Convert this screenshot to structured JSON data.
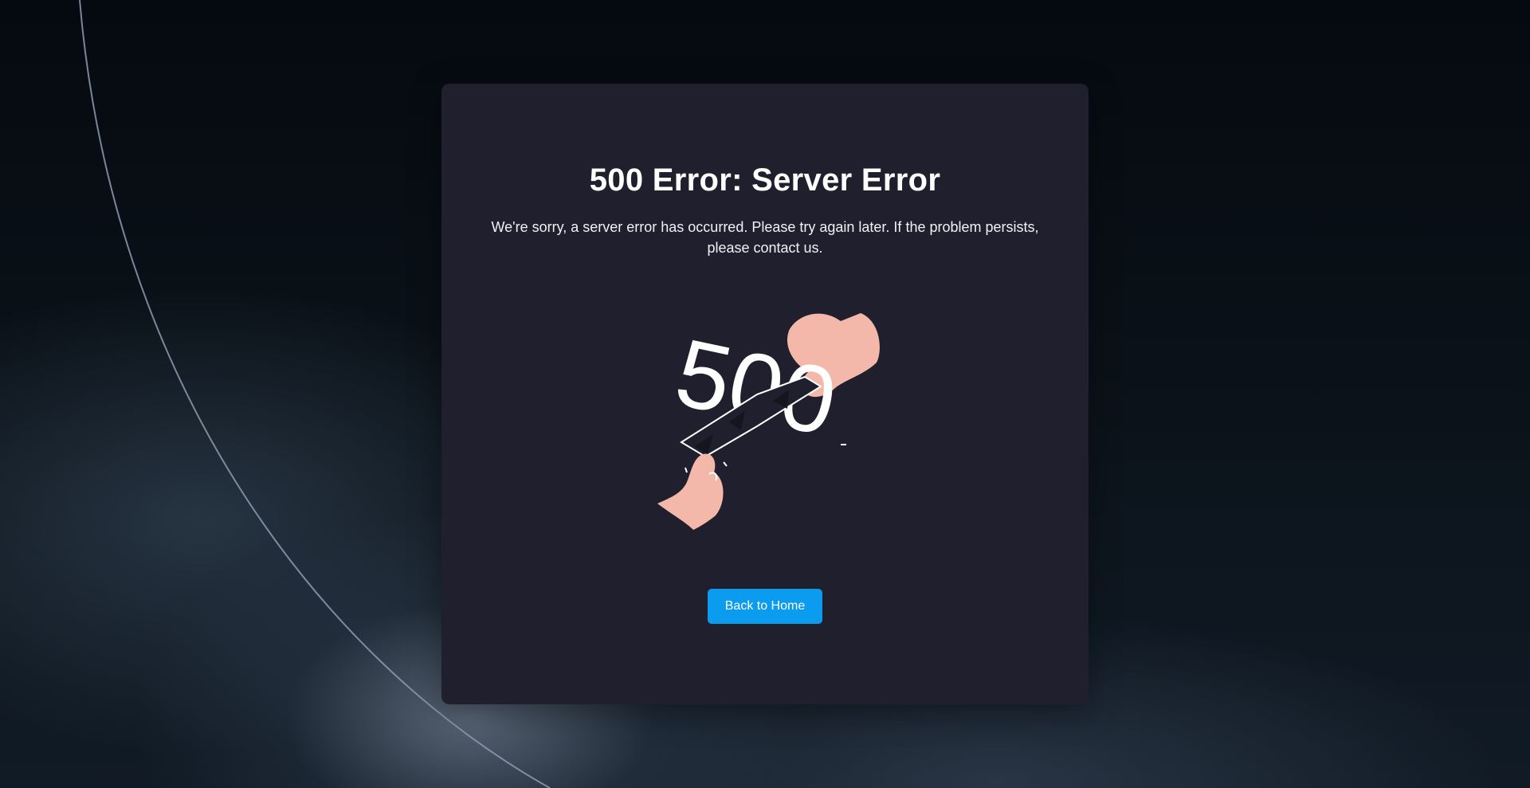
{
  "colors": {
    "card_bg": "#201f2e",
    "button_bg": "#0b9cf0",
    "text": "#ffffff",
    "hand": "#f3b8a9"
  },
  "error": {
    "title": "500 Error: Server Error",
    "message": "We're sorry, a server error has occurred. Please try again later. If the problem persists, please contact us.",
    "illustration_text": "500"
  },
  "actions": {
    "home_label": "Back to Home"
  },
  "icons": {
    "illustration": "hands-tearing-500-illustration"
  }
}
